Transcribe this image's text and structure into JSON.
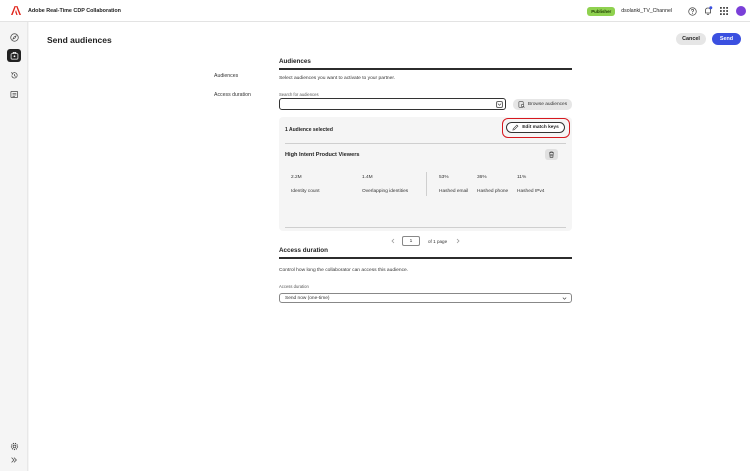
{
  "app": {
    "title": "Adobe Real-Time CDP Collaboration",
    "role_badge": "Publisher",
    "channel": "dsolanki_TV_Channel",
    "accent_color": "#3b50e0",
    "badge_color": "#8fd14f",
    "highlight_color": "#d7181f"
  },
  "topbar_icons": [
    "help-icon",
    "notification-bell-icon",
    "apps-grid-icon",
    "user-avatar"
  ],
  "sidebar_icons": [
    "compass-icon",
    "audiences-icon",
    "history-icon",
    "list-icon",
    "settings-icon",
    "expand-icon"
  ],
  "page": {
    "title": "Send audiences",
    "cancel_label": "Cancel",
    "send_label": "Send"
  },
  "steps": [
    "Audiences",
    "Access duration"
  ],
  "audiences": {
    "heading": "Audiences",
    "description": "Select audiences you want to activate to your partner.",
    "search_label": "Search for audiences",
    "search_value": "",
    "browse_label": "Browse audiences",
    "selected_count": "1 Audience selected",
    "edit_match_keys_label": "Edit match keys",
    "audience": {
      "name": "High Intent Product Viewers",
      "metrics": [
        {
          "value": "2.2M",
          "label": "Identity count"
        },
        {
          "value": "1.4M",
          "label": "Overlapping identities"
        },
        {
          "value": "53%",
          "label": "Hashed email"
        },
        {
          "value": "36%",
          "label": "Hashed phone"
        },
        {
          "value": "11%",
          "label": "Hashed IPv4"
        }
      ]
    },
    "pagination": {
      "current_page": "1",
      "of_label": "of 1 page"
    }
  },
  "access_duration": {
    "heading": "Access duration",
    "description": "Control how long the collaborator can access this audience.",
    "field_label": "Access duration",
    "selected_option": "Send now (one-time)"
  }
}
